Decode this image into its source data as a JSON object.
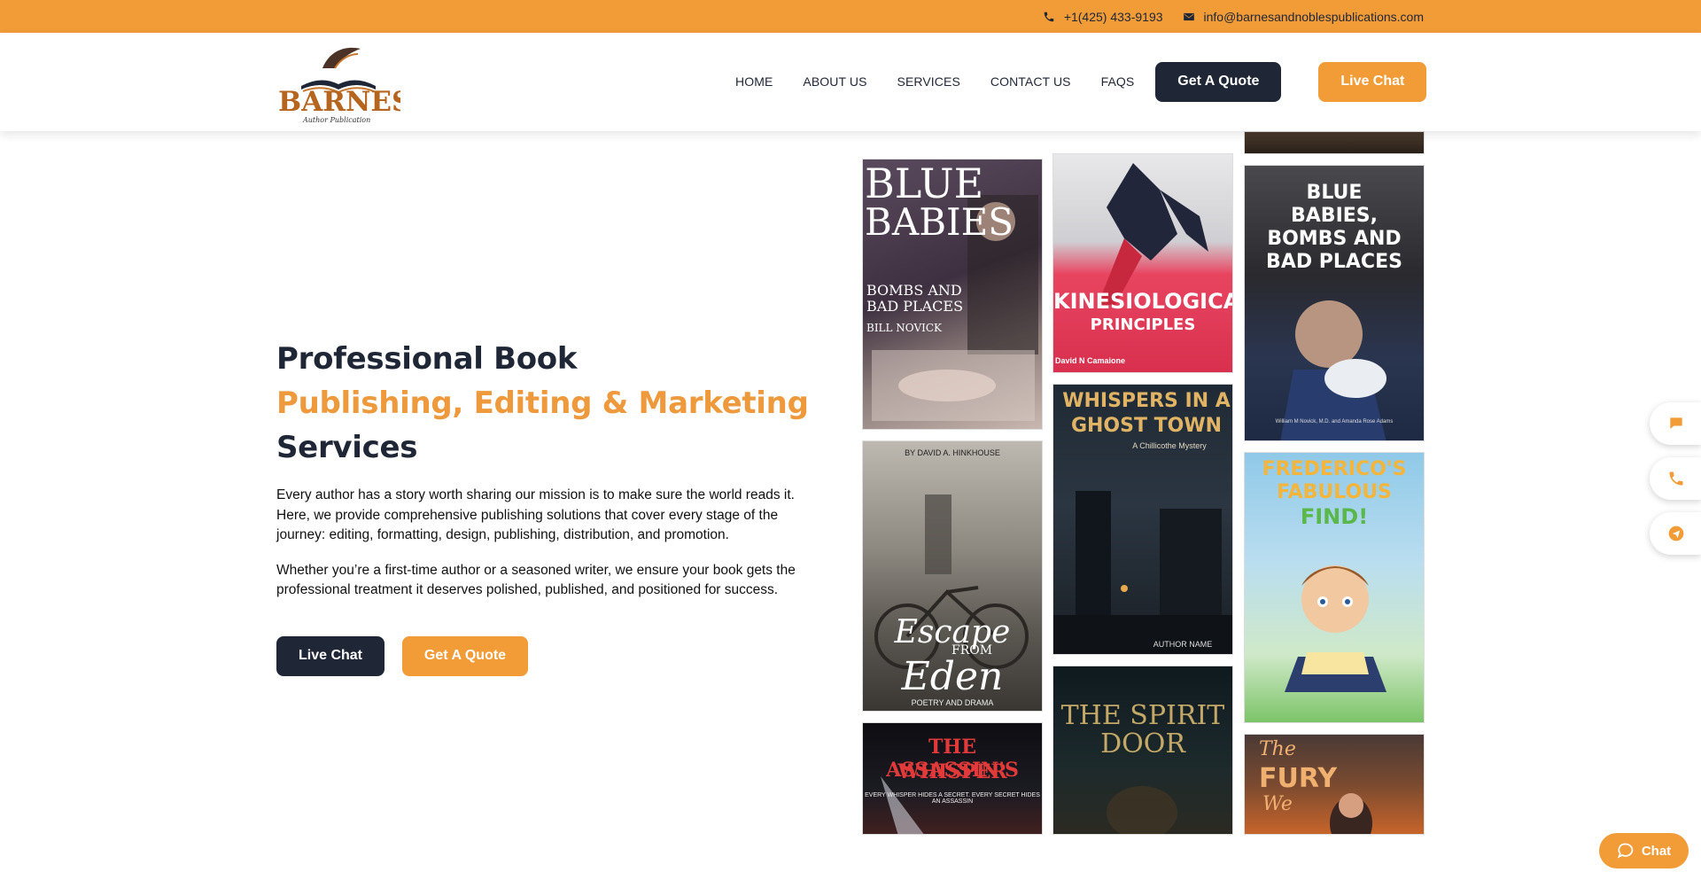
{
  "topbar": {
    "phone": "+1(425) 433-9193",
    "email": "info@barnesandnoblespublications.com"
  },
  "header": {
    "logo_text": "BARNES",
    "logo_subtext": "Author Publication",
    "nav": [
      "HOME",
      "ABOUT US",
      "SERVICES",
      "CONTACT US",
      "FAQS"
    ],
    "quote_label": "Get A Quote",
    "chat_label": "Live Chat"
  },
  "hero": {
    "title_line1": "Professional Book",
    "title_line2": "Publishing, Editing & Marketing",
    "title_line3": "Services",
    "para1": "Every author has a story worth sharing our mission is to make sure the world reads it. Here, we provide comprehensive publishing solutions that cover every stage of the journey: editing, formatting, design, publishing, distribution, and promotion.",
    "para2": "Whether you’re a first-time author or a seasoned writer, we ensure your book gets the professional treatment it deserves polished, published, and positioned for success.",
    "live_chat_label": "Live Chat",
    "quote_label": "Get A Quote"
  },
  "covers": {
    "blue_babies": {
      "title1": "BLUE",
      "title2": "BABIES",
      "sub1": "BOMBS AND",
      "sub2": "BAD PLACES",
      "author": "BILL NOVICK"
    },
    "kinesiological": {
      "title1": "KINESIOLOGICAL",
      "title2": "PRINCIPLES",
      "author": "David N Camaione"
    },
    "blue_babies_2": {
      "title": "BLUE BABIES, BOMBS AND BAD PLACES",
      "author": "William M Novick, M.D. and Amanda Rose Adams"
    },
    "escape_eden": {
      "author": "BY DAVID A. HINKHOUSE",
      "title1": "Escape",
      "title_from": "FROM",
      "title2": "Eden",
      "sub": "POETRY AND DRAMA"
    },
    "whispers": {
      "title1": "WHISPERS IN A",
      "title2": "GHOST TOWN",
      "sub": "A Chillicothe Mystery",
      "author": "AUTHOR NAME"
    },
    "frederico": {
      "title1": "FREDERICO'S",
      "title2": "FABULOUS",
      "title3": "FIND!"
    },
    "assassin": {
      "title1": "THE ASSASSIN'S",
      "title2": "WHISPER",
      "sub": "EVERY WHISPER HIDES A SECRET. EVERY SECRET HIDES AN ASSASSIN"
    },
    "spirit": {
      "title1": "THE SPIRIT",
      "title2": "DOOR"
    },
    "fury": {
      "title1": "The",
      "title2": "FURY",
      "title3": "We"
    }
  },
  "widgets": {
    "chat_label": "Chat"
  },
  "colors": {
    "brand_orange": "#f29c38",
    "brand_dark": "#1f2636"
  }
}
